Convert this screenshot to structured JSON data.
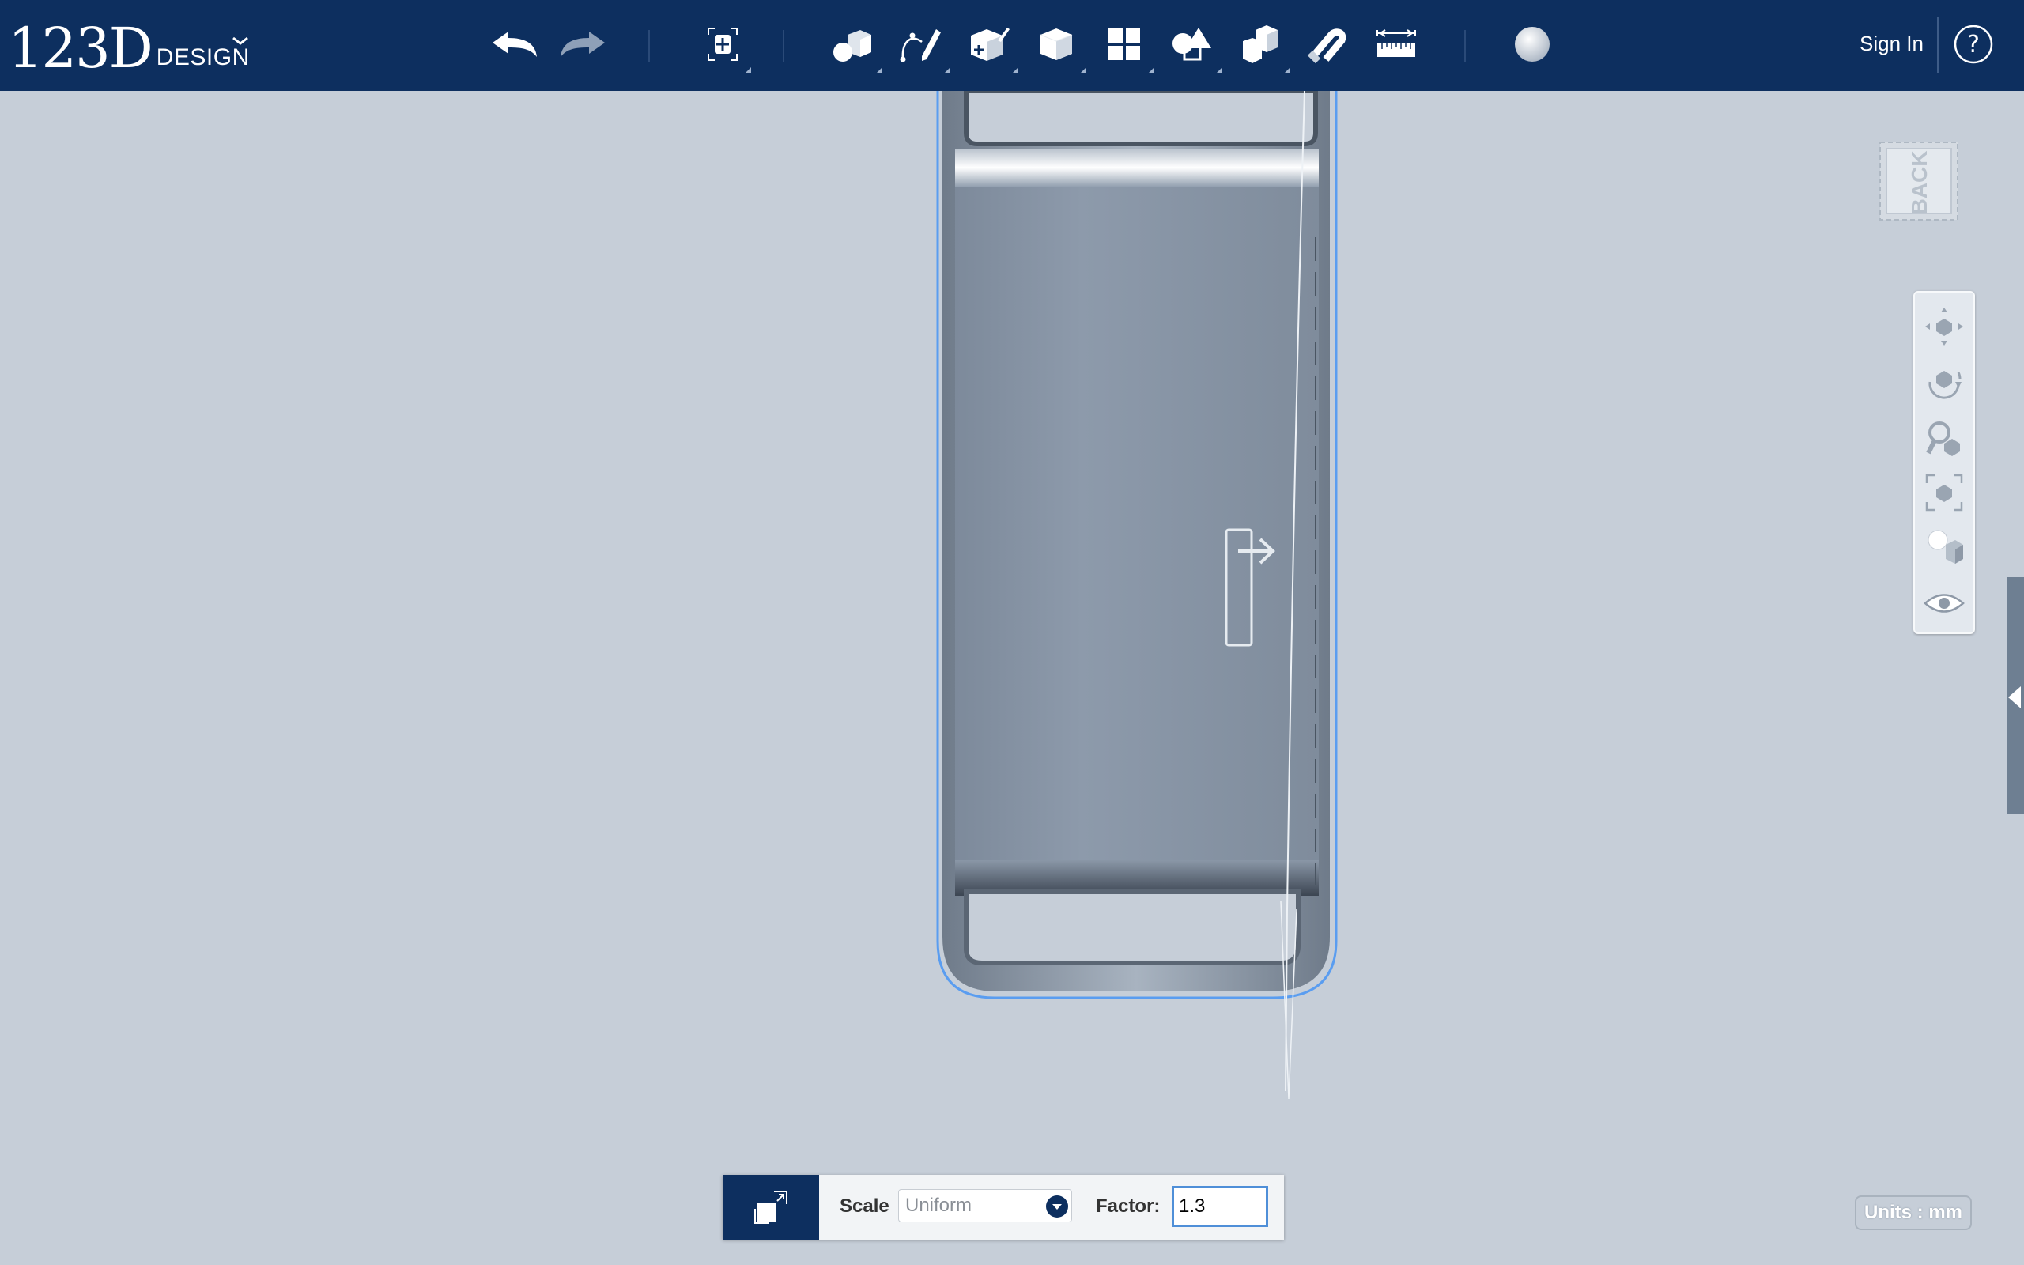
{
  "app": {
    "logo_number": "123D",
    "logo_word": "DESIGN"
  },
  "toolbar": {
    "items": [
      "undo-icon",
      "redo-icon",
      "transform-icon",
      "primitives-icon",
      "sketch-icon",
      "construct-icon",
      "modify-icon",
      "pattern-icon",
      "grouping-icon",
      "combine-icon",
      "snap-icon",
      "measure-icon",
      "material-icon"
    ],
    "sign_in": "Sign In",
    "help": "?"
  },
  "viewcube": {
    "face_label": "BACK"
  },
  "navbar": {
    "items": [
      "pan-icon",
      "orbit-icon",
      "zoom-icon",
      "fit-icon",
      "view-mode-icon",
      "visibility-icon"
    ]
  },
  "scale_panel": {
    "scale_label": "Scale",
    "scale_mode": "Uniform",
    "factor_label": "Factor:",
    "factor_value": "1.3"
  },
  "status": {
    "units": "Units : mm"
  },
  "colors": {
    "toolbar_bg": "#0d2f5f",
    "viewport_bg": "#c6ced8",
    "selection_outline": "#5a9df0",
    "model_body": "#8a97a7"
  }
}
